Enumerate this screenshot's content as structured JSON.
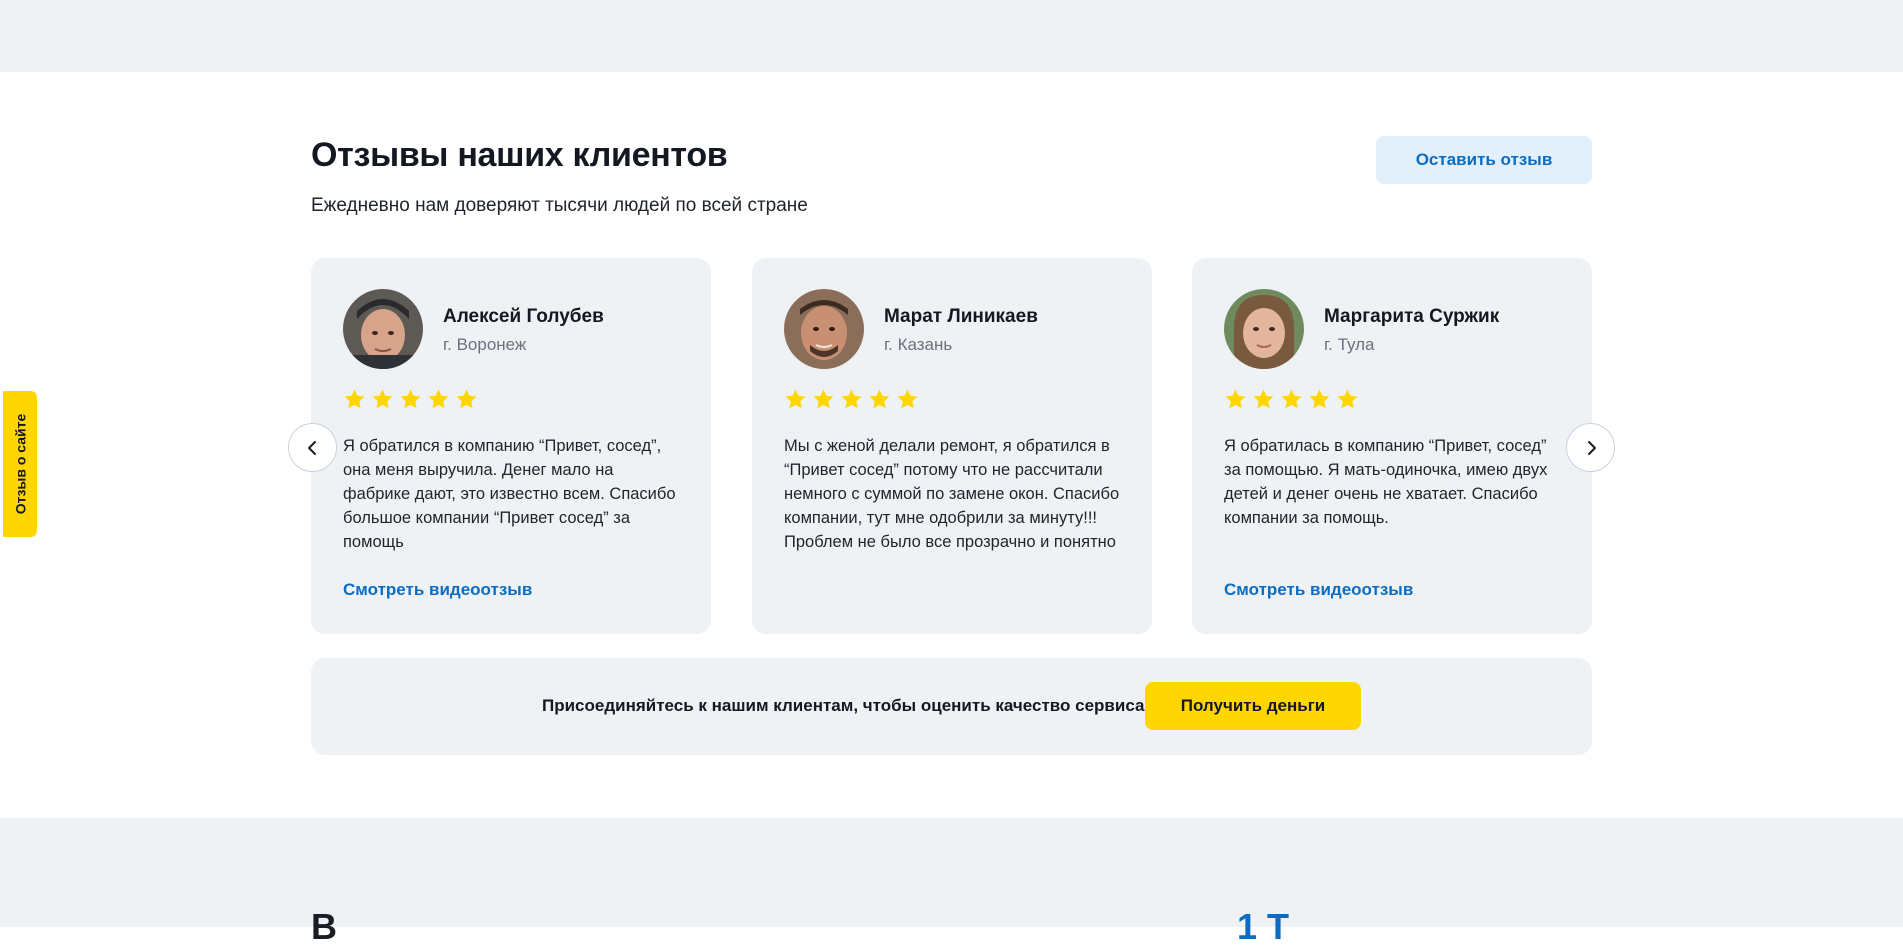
{
  "header": {
    "title": "Отзывы наших клиентов",
    "subtitle": "Ежедневно нам доверяют тысячи людей по всей стране",
    "leave_review_label": "Оставить отзыв"
  },
  "side_tab": {
    "label": "Отзыв о сайте"
  },
  "reviews": [
    {
      "name": "Алексей Голубев",
      "city": "г. Воронеж",
      "rating": 5,
      "text": "Я обратился в компанию “Привет, сосед”, она меня выручила. Денег мало на фабрике дают, это известно всем. Спасибо большое компании “Привет сосед” за помощь",
      "video_link": "Смотреть видеоотзыв"
    },
    {
      "name": "Марат Линикаев",
      "city": "г. Казань",
      "rating": 5,
      "text": "Мы с женой делали ремонт, я обратился в “Привет сосед” потому что не рассчитали немного с суммой по замене окон. Спасибо компании, тут мне одобрили за минуту!!! Проблем не было все прозрачно и понятно",
      "video_link": ""
    },
    {
      "name": "Маргарита Суржик",
      "city": "г. Тула",
      "rating": 5,
      "text": "Я обратилась в компанию “Привет, сосед” за помощью. Я мать-одиночка, имею двух детей и денег очень не хватает. Спасибо компании за помощь.",
      "video_link": "Смотреть видеоотзыв"
    }
  ],
  "carousel": {
    "prev_icon": "chevron-left-icon",
    "next_icon": "chevron-right-icon"
  },
  "cta": {
    "text": "Присоединяйтесь к нашим клиентам, чтобы оценить качество сервиса:",
    "button_label": "Получить деньги"
  },
  "next_section_peek": {
    "text_start": "В",
    "text_accent": "1 Т"
  },
  "colors": {
    "accent_blue": "#0a6cc2",
    "accent_yellow": "#ffd600",
    "card_bg": "#eff2f5",
    "star": "#ffd600"
  }
}
